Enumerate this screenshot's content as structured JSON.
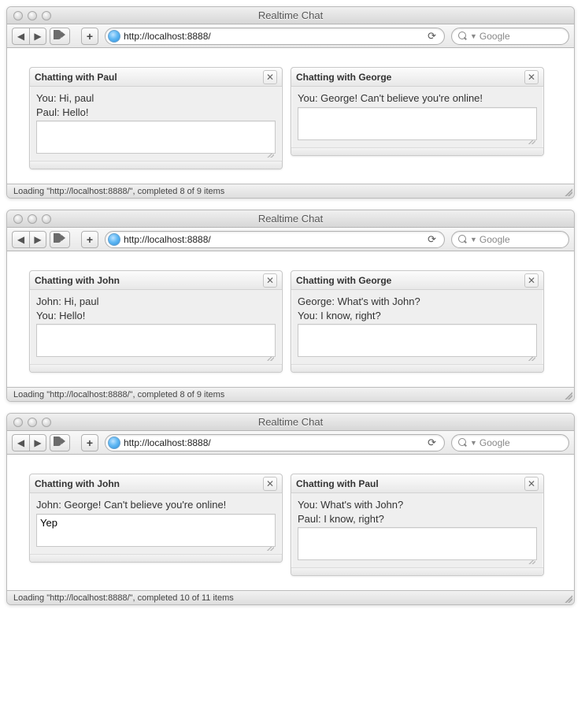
{
  "windows": [
    {
      "title": "Realtime Chat",
      "url": "http://localhost:8888/",
      "search_placeholder": "Google",
      "status": "Loading \"http://localhost:8888/\", completed 8 of 9 items",
      "chats": [
        {
          "title": "Chatting with Paul",
          "log": [
            "You: Hi, paul",
            "Paul: Hello!"
          ],
          "input": ""
        },
        {
          "title": "Chatting with George",
          "log": [
            "You: George! Can't believe you're online!"
          ],
          "input": ""
        }
      ]
    },
    {
      "title": "Realtime Chat",
      "url": "http://localhost:8888/",
      "search_placeholder": "Google",
      "status": "Loading \"http://localhost:8888/\", completed 8 of 9 items",
      "chats": [
        {
          "title": "Chatting with John",
          "log": [
            "John: Hi, paul",
            "You: Hello!"
          ],
          "input": ""
        },
        {
          "title": "Chatting with George",
          "log": [
            "George: What's with John?",
            "You: I know, right?"
          ],
          "input": ""
        }
      ]
    },
    {
      "title": "Realtime Chat",
      "url": "http://localhost:8888/",
      "search_placeholder": "Google",
      "status": "Loading \"http://localhost:8888/\", completed 10 of 11 items",
      "chats": [
        {
          "title": "Chatting with John",
          "log": [
            "John: George! Can't believe you're online!"
          ],
          "input": "Yep"
        },
        {
          "title": "Chatting with Paul",
          "log": [
            "You: What's with John?",
            "Paul: I know, right?"
          ],
          "input": ""
        }
      ]
    }
  ]
}
